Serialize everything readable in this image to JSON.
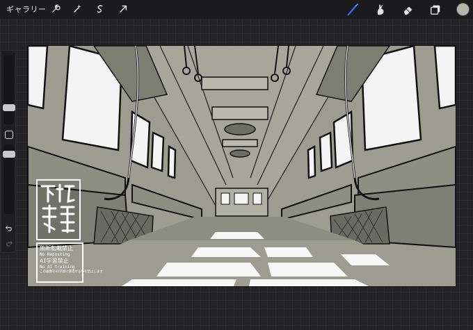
{
  "topbar": {
    "gallery_label": "ギャラリー",
    "left_tools": [
      "wrench-icon",
      "magic-wand-icon",
      "selection-icon",
      "transform-arrow-icon"
    ],
    "right_tools": [
      "brush-icon",
      "smudge-icon",
      "eraser-icon",
      "layers-icon"
    ],
    "active_tool": "brush-icon",
    "active_tool_color": "#2e6cf0",
    "current_color": "#b5b5a9"
  },
  "sidebar": {
    "tools": [
      "brush-size-slider",
      "modify-button",
      "opacity-slider",
      "undo-icon",
      "redo-icon"
    ]
  },
  "canvas": {
    "subject": "train carriage interior line art",
    "base_color": "#9c9d90",
    "stamp": {
      "seal_text": "不松篤",
      "handle": "@IGUCHIMATSURA",
      "notice_line1": "無断転載禁止",
      "notice_line2": "No Reposting",
      "notice_line3": "AI学習禁止",
      "notice_line4": "No AI training",
      "notice_line5": "この画像をAI学習に使用する事を禁止します"
    }
  }
}
